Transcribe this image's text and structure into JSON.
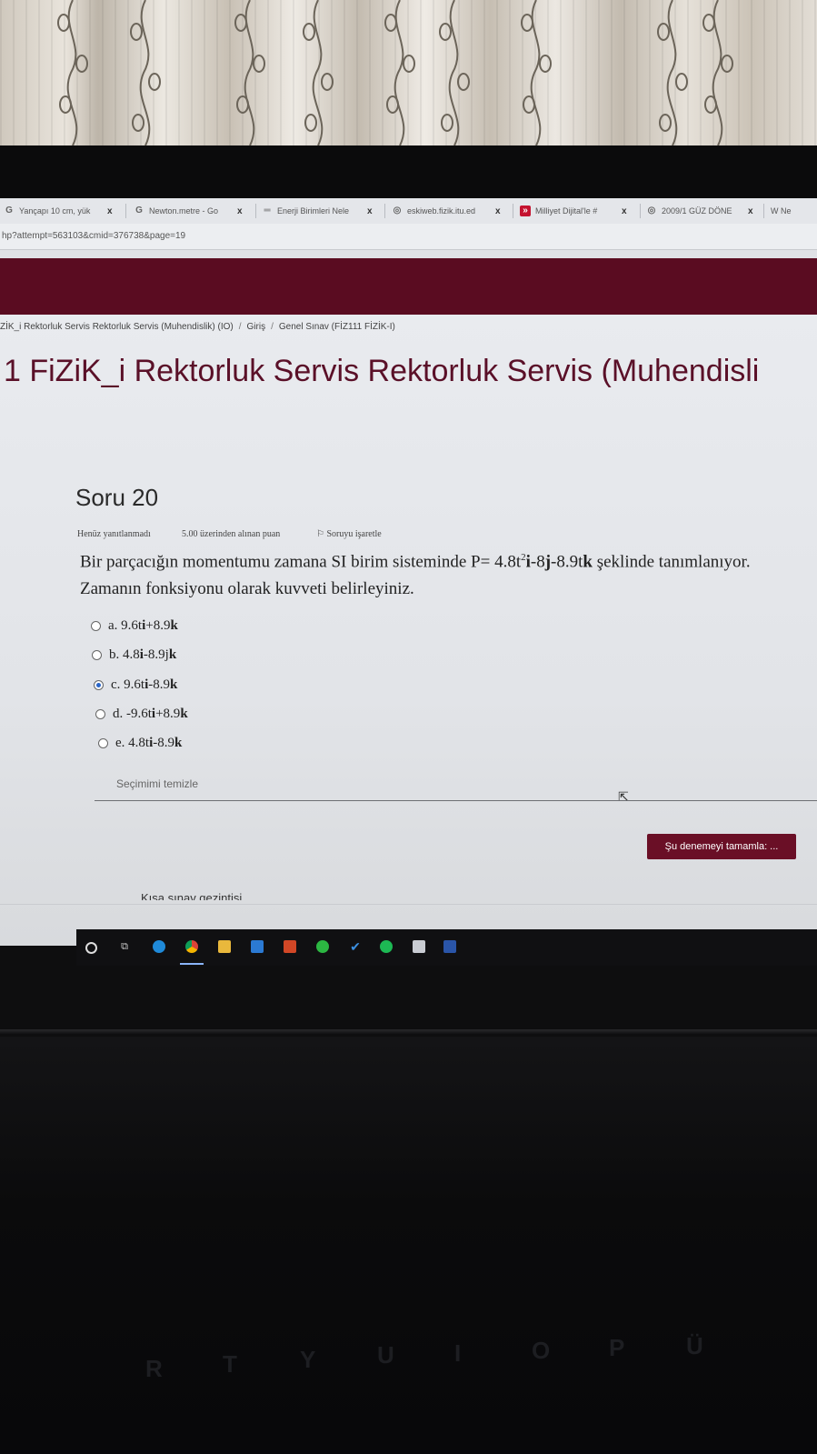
{
  "browser": {
    "tabs": [
      {
        "label": "Yançapı 10 cm, yük",
        "icon": "google-icon"
      },
      {
        "label": "Newton.metre - Go",
        "icon": "google-icon"
      },
      {
        "label": "Enerji Birimleri Nele",
        "icon": "site-icon"
      },
      {
        "label": "eskiweb.fizik.itu.ed",
        "icon": "globe-icon"
      },
      {
        "label": "Milliyet Dijital'le #",
        "icon": "milliyet-icon"
      },
      {
        "label": "2009/1 GÜZ DÖNE",
        "icon": "globe-icon"
      },
      {
        "label": "W Ne",
        "icon": "wikipedia-icon"
      }
    ],
    "tab_close": "x",
    "url": "hp?attempt=563103&cmid=376738&page=19"
  },
  "breadcrumb": {
    "items": [
      "ZİK_i Rektorluk Servis Rektorluk Servis (Muhendislik) (IO)",
      "Giriş",
      "Genel Sınav (FİZ111 FİZİK-I)"
    ],
    "separator": "/"
  },
  "course_title": "1 FiZiK_i Rektorluk Servis Rektorluk Servis (Muhendisli",
  "question": {
    "number_label": "Soru 20",
    "status": "Henüz yanıtlanmadı",
    "points": "5.00 üzerinden alınan puan",
    "flag_label": "Soruyu işaretle",
    "text_part1": "Bir parçacığın momentumu zamana SI birim sisteminde P= 4.8t",
    "text_sup": "2",
    "text_i": "i",
    "text_part2": "-8",
    "text_j": "j",
    "text_part3": "-8.9t",
    "text_k": "k",
    "text_part4": " şeklinde tanımlanıyor. Zamanın fonksiyonu olarak kuvveti belirleyiniz.",
    "options": [
      {
        "letter": "a.",
        "pre": "9.6t",
        "b1": "i",
        "mid": "+8.9",
        "b2": "k",
        "post": "",
        "selected": false
      },
      {
        "letter": "b.",
        "pre": "4.8",
        "b1": "i",
        "mid": "-8.9j",
        "b2": "k",
        "post": "",
        "selected": false
      },
      {
        "letter": "c.",
        "pre": "9.6t",
        "b1": "i",
        "mid": "-8.9",
        "b2": "k",
        "post": "",
        "selected": true
      },
      {
        "letter": "d.",
        "pre": "-9.6t",
        "b1": "i",
        "mid": "+8.9",
        "b2": "k",
        "post": "",
        "selected": false
      },
      {
        "letter": "e.",
        "pre": "4.8t",
        "b1": "i",
        "mid": "-8.9",
        "b2": "k",
        "post": "",
        "selected": false
      }
    ],
    "clear_label": "Seçimimi temizle"
  },
  "finish_button": "Şu denemeyi tamamla: ...",
  "quiz_nav_title": "Kısa sınav gezintisi",
  "colors": {
    "brand_maroon": "#5a0c21",
    "title_maroon": "#5a1028",
    "radio_selected": "#2a66c9"
  },
  "taskbar": {
    "icons": [
      "search-circle-icon",
      "task-view-icon",
      "edge-icon",
      "chrome-icon",
      "file-explorer-icon",
      "mail-icon",
      "office-icon",
      "whatsapp-icon",
      "check-icon",
      "spotify-icon",
      "package-icon",
      "app-icon"
    ]
  },
  "keyboard_keys": [
    "R",
    "T",
    "Y",
    "U",
    "I",
    "O",
    "P",
    "Ü"
  ]
}
